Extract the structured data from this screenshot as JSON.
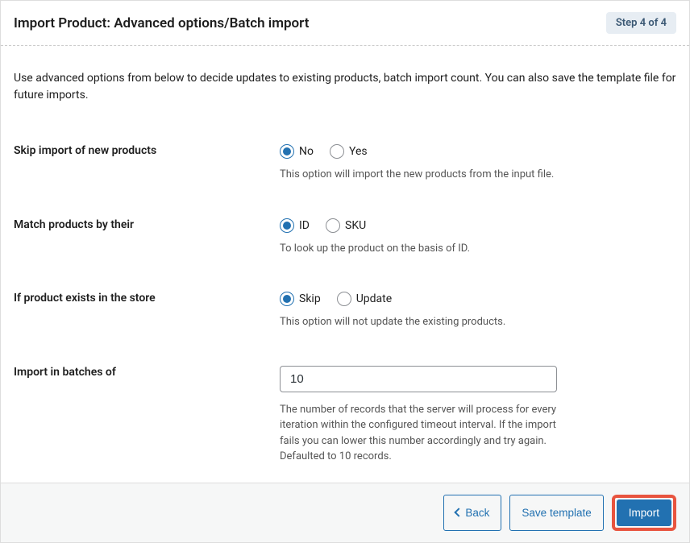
{
  "header": {
    "title": "Import Product: Advanced options/Batch import",
    "step": "Step 4 of 4"
  },
  "intro": "Use advanced options from below to decide updates to existing products, batch import count. You can also save the template file for future imports.",
  "rows": {
    "skip_new": {
      "label": "Skip import of new products",
      "option_no": "No",
      "option_yes": "Yes",
      "helper": "This option will import the new products from the input file."
    },
    "match_by": {
      "label": "Match products by their",
      "option_id": "ID",
      "option_sku": "SKU",
      "helper": "To look up the product on the basis of ID."
    },
    "if_exists": {
      "label": "If product exists in the store",
      "option_skip": "Skip",
      "option_update": "Update",
      "helper": "This option will not update the existing products."
    },
    "batch": {
      "label": "Import in batches of",
      "value": "10",
      "helper": "The number of records that the server will process for every iteration within the configured timeout interval. If the import fails you can lower this number accordingly and try again. Defaulted to 10 records."
    }
  },
  "footer": {
    "back": "Back",
    "save_template": "Save template",
    "import": "Import"
  }
}
